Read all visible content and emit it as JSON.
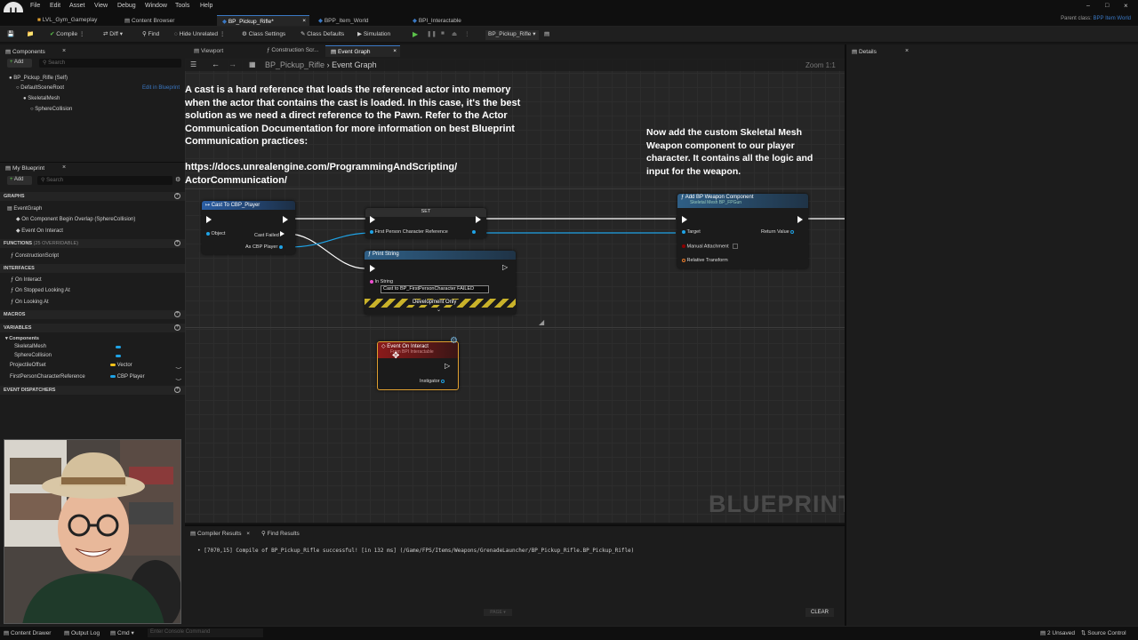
{
  "menu": [
    "File",
    "Edit",
    "Asset",
    "View",
    "Debug",
    "Window",
    "Tools",
    "Help"
  ],
  "tabs": [
    {
      "label": "LVL_Gym_Gameplay",
      "active": false
    },
    {
      "label": "Content Browser",
      "active": false
    },
    {
      "label": "BP_Pickup_Rifle*",
      "active": true
    },
    {
      "label": "BPP_Item_World",
      "active": false
    },
    {
      "label": "BPI_Interactable",
      "active": false
    }
  ],
  "parent_class": {
    "label": "Parent class:",
    "value": "BPP Item World"
  },
  "toolbar": {
    "compile": "Compile",
    "diff": "Diff",
    "find": "Find",
    "hide_unrelated": "Hide Unrelated",
    "class_settings": "Class Settings",
    "class_defaults": "Class Defaults",
    "simulation": "Simulation",
    "debug_object": "BP_Pickup_Rifle"
  },
  "components_panel": {
    "title": "Components",
    "add": "Add",
    "search_placeholder": "Search",
    "self": "BP_Pickup_Rifle (Self)",
    "edit_link": "Edit in Blueprint",
    "tree": [
      "DefaultSceneRoot",
      "SkeletalMesh",
      "SphereCollision"
    ]
  },
  "my_blueprint": {
    "title": "My Blueprint",
    "add": "Add",
    "search_placeholder": "Search",
    "graphs_header": "GRAPHS",
    "event_graph": "EventGraph",
    "graph_items": [
      "On Component Begin Overlap (SphereCollision)",
      "Event On Interact"
    ],
    "functions_header": "FUNCTIONS",
    "functions_overridable": "(25 OVERRIDABLE)",
    "functions": [
      "ConstructionScript"
    ],
    "interfaces_header": "INTERFACES",
    "interfaces": [
      "On Interact",
      "On Stopped Looking At",
      "On Looking At"
    ],
    "macros_header": "MACROS",
    "variables_header": "VARIABLES",
    "components_header": "Components",
    "component_vars": [
      "SkeletalMesh",
      "SphereCollision"
    ],
    "variables": [
      {
        "name": "ProjectileOffset",
        "type": "Vector"
      },
      {
        "name": "FirstPersonCharacterReference",
        "type": "CBP Player"
      }
    ],
    "dispatchers_header": "EVENT DISPATCHERS"
  },
  "graph_tabs": [
    "Viewport",
    "Construction Scr...",
    "Event Graph"
  ],
  "breadcrumb": {
    "root": "BP_Pickup_Rifle",
    "current": "Event Graph"
  },
  "zoom": "Zoom 1:1",
  "comments": {
    "left": [
      "A cast is a hard reference that loads the referenced actor into memory",
      "when the actor that contains the cast is loaded. In this case, it's the best",
      "solution as we need a direct reference to the Pawn. Refer to the Actor",
      "Communication Documentation for more information on best Blueprint",
      "Communication practices:",
      "",
      "https://docs.unrealengine.com/ProgrammingAndScripting/",
      "ActorCommunication/"
    ],
    "right": [
      "Now add the custom Skeletal Mesh",
      "Weapon component to our player",
      "character. It contains all the logic and",
      "input for the weapon."
    ]
  },
  "nodes": {
    "cast": {
      "title": "Cast To CBP_Player",
      "object": "Object",
      "failed": "Cast Failed",
      "as": "As CBP Player"
    },
    "set": {
      "title": "SET",
      "pin": "First Person Character Reference"
    },
    "print": {
      "title": "Print String",
      "in_string": "In String",
      "value": "Cast to BP_FirstPersonCharacter FAILED",
      "dev": "Development Only"
    },
    "add_comp": {
      "title": "Add BP Weapon Component",
      "subtitle": "Skeletal Mesh BP_FPGun",
      "target": "Target",
      "return": "Return Value",
      "manual": "Manual Attachment",
      "relative": "Relative Transform"
    },
    "event": {
      "title": "Event On Interact",
      "subtitle": "From BPI Interactable",
      "instigator": "Instigator"
    }
  },
  "watermark": "BLUEPRINT",
  "details_title": "Details",
  "bottom_tabs": [
    "Compiler Results",
    "Find Results"
  ],
  "compile_log": "[7070,15] Compile of BP_Pickup_Rifle successful! [in 132 ms] (/Game/FPS/Items/Weapons/GrenadeLauncher/BP_Pickup_Rifle.BP_Pickup_Rifle)",
  "page_label": "PAGE",
  "clear": "CLEAR",
  "statusbar": {
    "content_drawer": "Content Drawer",
    "output_log": "Output Log",
    "cmd": "Cmd",
    "console_placeholder": "Enter Console Command",
    "unsaved": "2 Unsaved",
    "source_control": "Source Control"
  },
  "colors": {
    "accent_blue": "#3a78c4",
    "exec_white": "#ffffff",
    "object_pin": "#1fa3e6",
    "struct_pin": "#e6792a",
    "vector_pin": "#f2c21a",
    "bool_pin": "#8b0000",
    "string_pin": "#f04fd1",
    "event_header": "#8b1a1a",
    "cast_header": "#2b5ea3",
    "func_header": "#2f5f86"
  }
}
